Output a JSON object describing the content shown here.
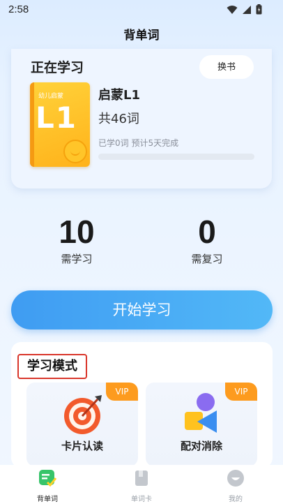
{
  "status_bar": {
    "time": "2:58"
  },
  "nav": {
    "title": "背单词"
  },
  "study": {
    "section_title": "正在学习",
    "change_book_label": "换书",
    "book": {
      "cover_tag": "幼儿启蒙",
      "cover_code": "L1",
      "name": "启蒙L1",
      "word_count": "共46词",
      "progress_text": "已学0词 预计5天完成",
      "progress_fraction": 0
    }
  },
  "stats": [
    {
      "value": "10",
      "label": "需学习"
    },
    {
      "value": "0",
      "label": "需复习"
    }
  ],
  "start_button": {
    "label": "开始学习"
  },
  "modes": {
    "title": "学习模式",
    "items": [
      {
        "label": "卡片认读",
        "badge": "VIP"
      },
      {
        "label": "配对消除",
        "badge": "VIP"
      }
    ]
  },
  "tabs": [
    {
      "label": "背单词",
      "active": true
    },
    {
      "label": "单词卡",
      "active": false
    },
    {
      "label": "我的",
      "active": false
    }
  ],
  "colors": {
    "accent": "#3f9cf2",
    "vip": "#fd9b1e",
    "book": "#ffc21f"
  }
}
